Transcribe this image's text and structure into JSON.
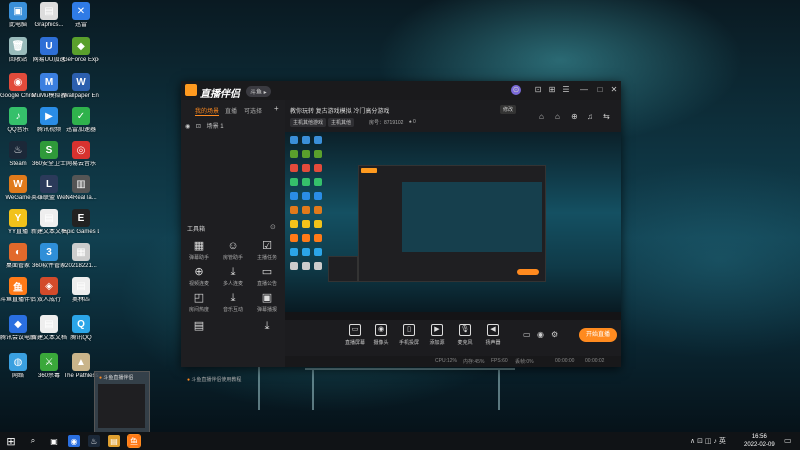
{
  "desktop": {
    "icons": [
      {
        "label": "此电脑",
        "color": "#3a8fd8",
        "glyph": "▣",
        "icon": "computer-icon"
      },
      {
        "label": "Graphics...",
        "color": "#ddd",
        "glyph": "▤",
        "icon": "file-icon"
      },
      {
        "label": "迅雷",
        "color": "#2f7be6",
        "glyph": "✕",
        "icon": "thunder-icon"
      },
      {
        "label": "回收站",
        "color": "#9bb",
        "glyph": "🗑",
        "icon": "recycle-bin-icon"
      },
      {
        "label": "网易UU加速",
        "color": "#2e6fd6",
        "glyph": "U",
        "icon": "uu-icon"
      },
      {
        "label": "GeForce Experience",
        "color": "#5aa02c",
        "glyph": "◆",
        "icon": "geforce-icon"
      },
      {
        "label": "Google Chrome",
        "color": "#e24b3b",
        "glyph": "◉",
        "icon": "chrome-icon"
      },
      {
        "label": "MuMu模拟器",
        "color": "#3b7fe0",
        "glyph": "M",
        "icon": "mumu-icon"
      },
      {
        "label": "Wallpaper Engine",
        "color": "#2c5fae",
        "glyph": "W",
        "icon": "wallpaper-engine-icon"
      },
      {
        "label": "QQ音乐",
        "color": "#35c06b",
        "glyph": "♪",
        "icon": "qq-music-icon"
      },
      {
        "label": "腾讯视频",
        "color": "#2a8de6",
        "glyph": "▶",
        "icon": "tencent-video-icon"
      },
      {
        "label": "迅雷加速器",
        "color": "#2fb24c",
        "glyph": "✓",
        "icon": "accelerator-icon"
      },
      {
        "label": "Steam",
        "color": "#1b2838",
        "glyph": "♨",
        "icon": "steam-icon"
      },
      {
        "label": "360安全卫士",
        "color": "#2f9a3a",
        "glyph": "S",
        "icon": "360-safe-icon"
      },
      {
        "label": "网易云音乐",
        "color": "#d8322f",
        "glyph": "◎",
        "icon": "netease-music-icon"
      },
      {
        "label": "WeGame",
        "color": "#e07a1b",
        "glyph": "W",
        "icon": "wegame-icon"
      },
      {
        "label": "英雄联盟 WeGame版",
        "color": "#2b3a5a",
        "glyph": "L",
        "icon": "lol-icon"
      },
      {
        "label": "N4RealTa...",
        "color": "#555",
        "glyph": "▥",
        "icon": "file-icon"
      },
      {
        "label": "YY直播",
        "color": "#f2c21a",
        "glyph": "Y",
        "icon": "yy-icon"
      },
      {
        "label": "新建文本文档",
        "color": "#eee",
        "glyph": "▤",
        "icon": "text-file-icon"
      },
      {
        "label": "Epic Games Launcher",
        "color": "#222",
        "glyph": "E",
        "icon": "epic-icon"
      },
      {
        "label": "桌面管家",
        "color": "#e2692b",
        "glyph": "◐",
        "icon": "desktop-manager-icon"
      },
      {
        "label": "360软件管家",
        "color": "#2f8fd8",
        "glyph": "3",
        "icon": "360-software-icon"
      },
      {
        "label": "20218221...",
        "color": "#ccc",
        "glyph": "▦",
        "icon": "image-file-icon"
      },
      {
        "label": "斗鱼直播伴侣",
        "color": "#ff7a18",
        "glyph": "鱼",
        "icon": "douyu-icon"
      },
      {
        "label": "双人成行",
        "color": "#d34b2b",
        "glyph": "◈",
        "icon": "game-icon"
      },
      {
        "label": "奥林匹",
        "color": "#eee",
        "glyph": "▤",
        "icon": "document-icon"
      },
      {
        "label": "腾讯会议电脑",
        "color": "#2a6fe0",
        "glyph": "◆",
        "icon": "tencent-meeting-icon"
      },
      {
        "label": "新建文本文档",
        "color": "#eee",
        "glyph": "▤",
        "icon": "text-file-icon"
      },
      {
        "label": "腾讯QQ",
        "color": "#2ba5e8",
        "glyph": "Q",
        "icon": "qq-icon"
      },
      {
        "label": "网络",
        "color": "#3aa0e0",
        "glyph": "◍",
        "icon": "network-icon"
      },
      {
        "label": "360杀毒",
        "color": "#3aa83a",
        "glyph": "⚔",
        "icon": "360-antivirus-icon"
      },
      {
        "label": "The Pathless",
        "color": "#c9b48a",
        "glyph": "▲",
        "icon": "game-icon"
      }
    ]
  },
  "app": {
    "title": "直播伴侣",
    "version": "斗鱼 ▸",
    "titlebar_buttons": [
      "⊙",
      "⊡",
      "⊞",
      "☰",
      "—",
      "□",
      "✕"
    ],
    "scene_tabs": [
      "我的场景",
      "直播",
      "可选择"
    ],
    "add_scene": "+",
    "scene_item": "场景 1",
    "tools_label": "工具箱",
    "tools": [
      {
        "label": "弹幕助手",
        "glyph": "▦",
        "icon": "danmaku-icon"
      },
      {
        "label": "房管助手",
        "glyph": "☺",
        "icon": "room-admin-icon"
      },
      {
        "label": "主播任务",
        "glyph": "☑",
        "icon": "task-icon"
      },
      {
        "label": "视频连麦",
        "glyph": "⊕",
        "icon": "video-link-icon"
      },
      {
        "label": "多人连麦",
        "glyph": "⤓",
        "icon": "multi-link-icon"
      },
      {
        "label": "直播公告",
        "glyph": "▭",
        "icon": "notice-icon"
      },
      {
        "label": "房间热度",
        "glyph": "◰",
        "icon": "heat-icon"
      },
      {
        "label": "音乐互动",
        "glyph": "⤓",
        "icon": "music-icon"
      },
      {
        "label": "弹幕播报",
        "glyph": "▣",
        "icon": "broadcast-icon"
      },
      {
        "label": "",
        "glyph": "▤",
        "icon": "tool-more-icon"
      },
      {
        "label": "",
        "glyph": "",
        "icon": "blank"
      },
      {
        "label": "",
        "glyph": "⤓",
        "icon": "download-icon"
      }
    ],
    "bottom_tip": "斗鱼直播伴侣使用教程",
    "room": {
      "title": "教你玩转 复古游戏模拟 冷门高分游戏",
      "edit_label": "修改",
      "category": "主机其他游戏",
      "subcategory": "主机其他",
      "room_no": "房号：8719102",
      "fans": "0"
    },
    "header_icons": [
      "⌂",
      "⌂",
      "⊕",
      "♫",
      "⇆"
    ],
    "controls": [
      {
        "label": "直播屏幕",
        "glyph": "▭",
        "icon": "screen-capture-icon"
      },
      {
        "label": "摄像头",
        "glyph": "◉",
        "icon": "camera-icon"
      },
      {
        "label": "手机投屏",
        "glyph": "▯",
        "icon": "phone-cast-icon"
      },
      {
        "label": "添加源",
        "glyph": "▶",
        "icon": "add-source-icon"
      },
      {
        "label": "麦克风",
        "glyph": "🎙",
        "icon": "microphone-icon"
      },
      {
        "label": "扬声器",
        "glyph": "◀",
        "icon": "speaker-icon"
      }
    ],
    "control_extra": [
      "▭",
      "◉",
      "⚙"
    ],
    "live_button": "开始直播",
    "status": [
      "CPU:12%",
      "内存:45%",
      "FPS:60",
      "丢帧:0%",
      "00:00:00",
      "00:00:02"
    ]
  },
  "thumbnail": {
    "title": "斗鱼直播伴侣"
  },
  "taskbar": {
    "start_glyph": "⊞",
    "apps": [
      {
        "glyph": "⌕",
        "color": "#101316",
        "icon": "search-icon"
      },
      {
        "glyph": "▣",
        "color": "#101316",
        "icon": "task-view-icon"
      },
      {
        "glyph": "◉",
        "color": "#2a6fe0",
        "icon": "edge-icon"
      },
      {
        "glyph": "♨",
        "color": "#1b2838",
        "icon": "steam-taskbar-icon"
      },
      {
        "glyph": "▤",
        "color": "#e0a030",
        "icon": "explorer-icon"
      },
      {
        "glyph": "鱼",
        "color": "#ff7a18",
        "icon": "douyu-taskbar-icon"
      }
    ],
    "tray": "∧  ⊡  ◫  ♪  英",
    "time": "16:56",
    "date": "2022-02-09"
  },
  "colors": {
    "accent": "#ff8a1f",
    "window_bg": "#1c1c1f"
  }
}
